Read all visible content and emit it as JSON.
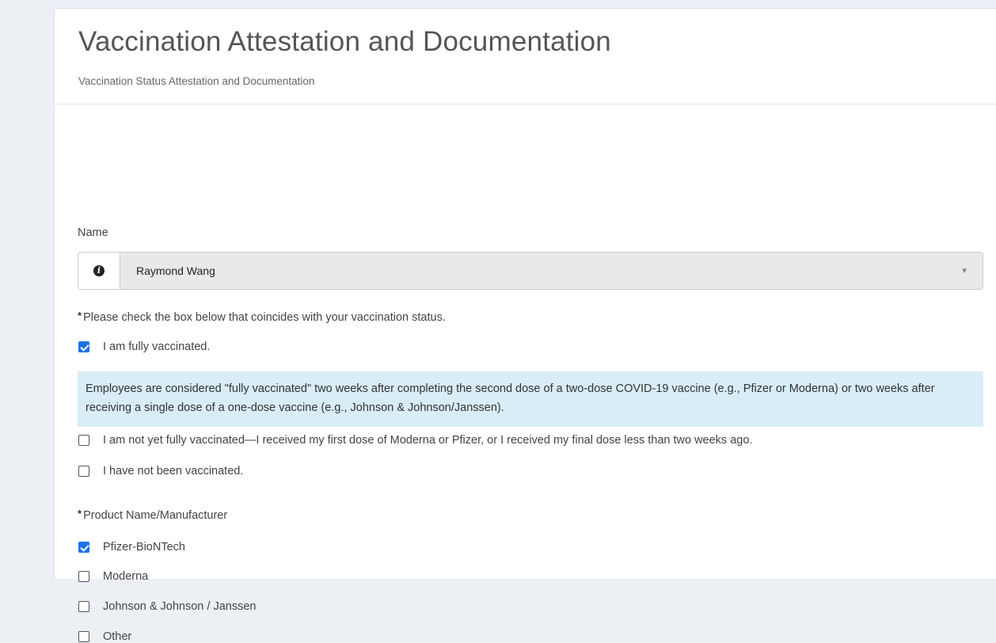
{
  "header": {
    "title": "Vaccination Attestation and Documentation",
    "subtitle": "Vaccination Status Attestation and Documentation"
  },
  "name_field": {
    "label": "Name",
    "value": "Raymond Wang",
    "info_icon": "info-circle-icon",
    "caret_icon": "caret-down-icon"
  },
  "vaccination_status": {
    "required_marker": "*",
    "label": "Please check the box below that coincides with your vaccination status.",
    "options": [
      {
        "label": "I am fully vaccinated.",
        "checked": true
      },
      {
        "label": "I am not yet fully vaccinated—I received my first dose of Moderna or Pfizer, or I received my final dose less than two weeks ago.",
        "checked": false
      },
      {
        "label": "I have not been vaccinated.",
        "checked": false
      }
    ],
    "info_text": "Employees are considered \"fully vaccinated\" two weeks after completing the second dose of a two-dose COVID-19 vaccine (e.g., Pfizer or Moderna) or two weeks after receiving a single dose of a one-dose vaccine (e.g., Johnson & Johnson/Janssen)."
  },
  "product": {
    "required_marker": "*",
    "label": "Product Name/Manufacturer",
    "options": [
      {
        "label": "Pfizer-BioNTech",
        "checked": true
      },
      {
        "label": "Moderna",
        "checked": false
      },
      {
        "label": "Johnson & Johnson / Janssen",
        "checked": false
      },
      {
        "label": "Other",
        "checked": false
      }
    ]
  },
  "colors": {
    "checkbox_checked": "#1a73e8",
    "info_box_bg": "#d9edf7",
    "select_bg": "#e9e9e9"
  }
}
